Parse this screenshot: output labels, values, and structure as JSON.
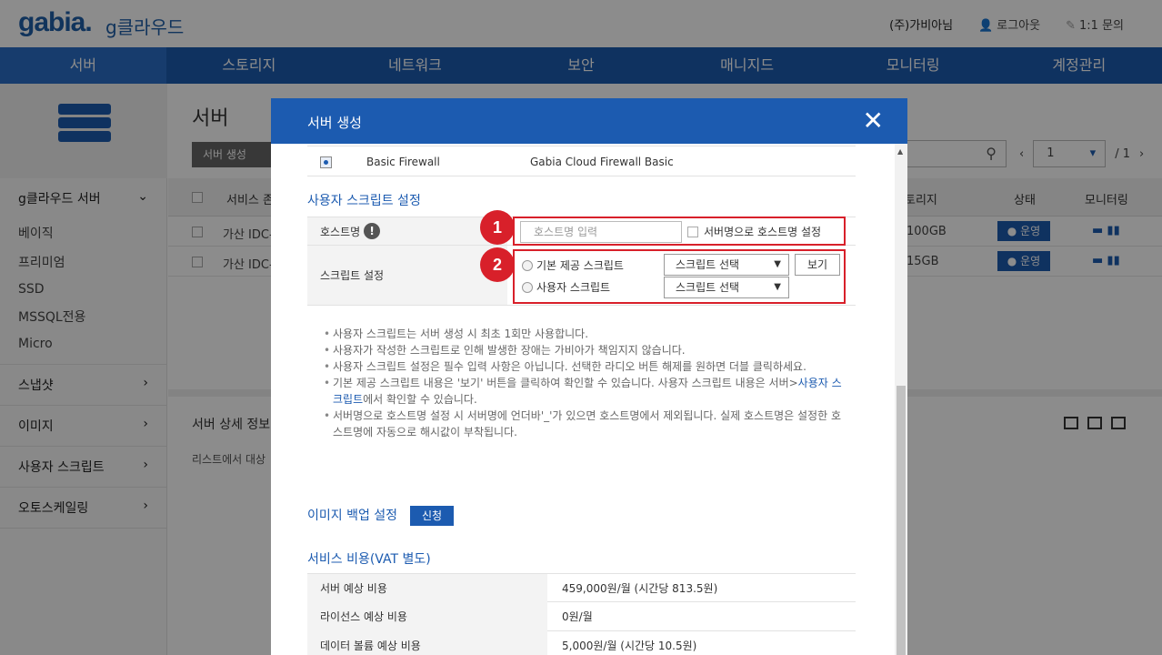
{
  "header": {
    "logo": "gabia.",
    "logo_sub": "g클라우드",
    "user": "(주)가비아님",
    "logout": "로그아웃",
    "inquiry": "1:1 문의"
  },
  "nav": [
    "서버",
    "스토리지",
    "네트워크",
    "보안",
    "매니지드",
    "모니터링",
    "계정관리"
  ],
  "sidebar": {
    "main": "g클라우드 서버",
    "subs": [
      "베이직",
      "프리미엄",
      "SSD",
      "MSSQL전용",
      "Micro"
    ],
    "sections": [
      "스냅샷",
      "이미지",
      "사용자 스크립트",
      "오토스케일링"
    ]
  },
  "content": {
    "title": "서버",
    "create_btn": "서버 생성",
    "page_current": "1",
    "page_total": "/ 1",
    "columns": {
      "name": "서비스 존",
      "storage": "토리지",
      "status": "상태",
      "monitoring": "모니터링"
    },
    "rows": [
      {
        "zone": "가산 IDC-",
        "storage": "100GB",
        "status": "운영"
      },
      {
        "zone": "가산 IDC-",
        "storage": "15GB",
        "status": "운영"
      }
    ],
    "detail_title": "서버 상세 정보",
    "detail_desc": "리스트에서 대상"
  },
  "modal": {
    "title": "서버 생성",
    "firewall": {
      "name": "Basic Firewall",
      "desc": "Gabia Cloud Firewall Basic"
    },
    "script_section": "사용자 스크립트 설정",
    "hostname_label": "호스트명",
    "hostname_placeholder": "호스트명 입력",
    "hostname_checkbox": "서버명으로 호스트명 설정",
    "script_label": "스크립트 설정",
    "radio_basic": "기본 제공 스크립트",
    "radio_user": "사용자 스크립트",
    "select_text": "스크립트 선택",
    "view_btn": "보기",
    "badge1": "1",
    "badge2": "2",
    "notes": [
      "사용자 스크립트는 서버 생성 시 최초 1회만 사용합니다.",
      "사용자가 작성한 스크립트로 인해 발생한 장애는 가비아가 책임지지 않습니다.",
      "사용자 스크립트 설정은 필수 입력 사항은 아닙니다. 선택한 라디오 버튼 해제를 원하면 더블 클릭하세요."
    ],
    "note4_a": "기본 제공 스크립트 내용은 '보기' 버튼을 클릭하여 확인할 수 있습니다. 사용자 스크립트 내용은 서버>",
    "note4_link": "사용자 스크립트",
    "note4_b": "에서 확인할 수 있습니다.",
    "note5": "서버명으로 호스트명 설정 시 서버명에 언더바'_'가 있으면 호스트명에서 제외됩니다. 실제 호스트명은 설정한 호스트명에 자동으로 해시값이 부착됩니다.",
    "backup_title": "이미지 백업 설정",
    "apply_btn": "신청",
    "cost_title": "서비스 비용(VAT 별도)",
    "costs": [
      {
        "label": "서버 예상 비용",
        "value": "459,000원/월 (시간당 813.5원)"
      },
      {
        "label": "라이선스 예상 비용",
        "value": "0원/월"
      },
      {
        "label": "데이터 볼륨 예상 비용",
        "value": "5,000원/월 (시간당 10.5원)"
      }
    ]
  },
  "colors": {
    "primary": "#1c5bb0",
    "highlight": "#d8202a"
  }
}
